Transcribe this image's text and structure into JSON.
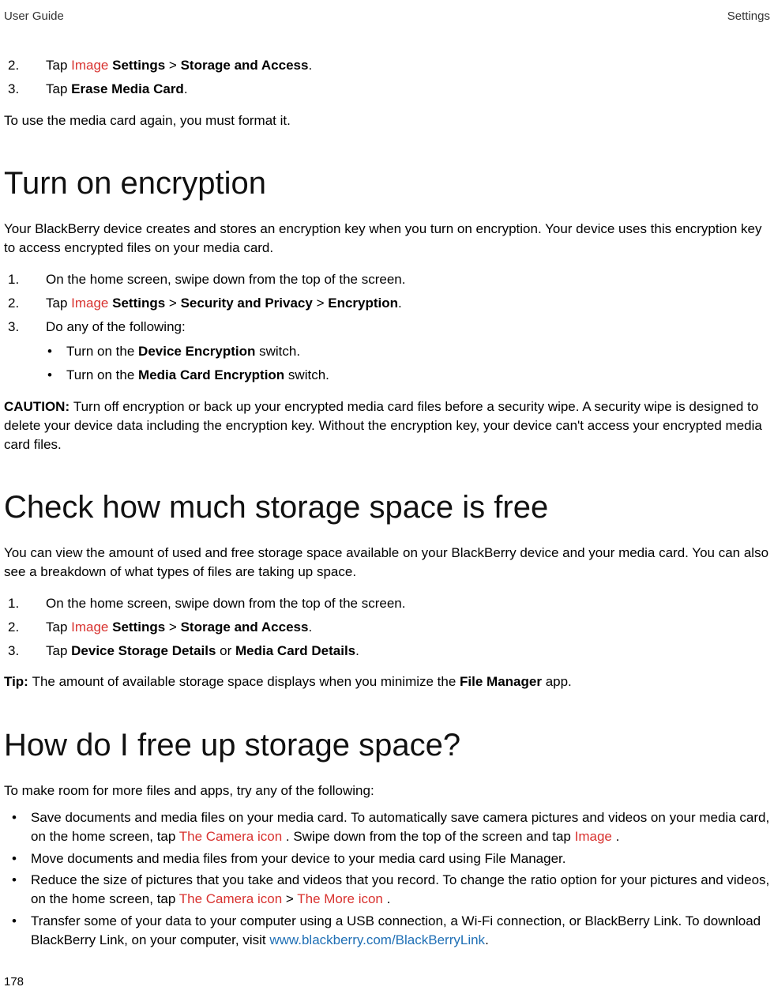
{
  "header": {
    "left": "User Guide",
    "right": "Settings"
  },
  "intro_list": {
    "items": [
      {
        "num": "2.",
        "pre": "Tap ",
        "image": "Image",
        "post": " ",
        "b1": "Settings",
        "sep": " > ",
        "b2": "Storage and Access",
        "end": "."
      },
      {
        "num": "3.",
        "pre": "Tap ",
        "b1": "Erase Media Card",
        "end": "."
      }
    ]
  },
  "intro_para": "To use the media card again, you must format it.",
  "section1": {
    "title": "Turn on encryption",
    "para": "Your BlackBerry device creates and stores an encryption key when you turn on encryption. Your device uses this encryption key to access encrypted files on your media card.",
    "items": [
      {
        "num": "1.",
        "text": "On the home screen, swipe down from the top of the screen."
      },
      {
        "num": "2.",
        "pre": "Tap ",
        "image": "Image",
        "post": " ",
        "b1": "Settings",
        "sep1": " > ",
        "b2": "Security and Privacy",
        "sep2": " > ",
        "b3": "Encryption",
        "end": "."
      },
      {
        "num": "3.",
        "text": "Do any of the following:"
      }
    ],
    "sub_items": [
      {
        "pre": "Turn on the ",
        "b": "Device Encryption",
        "post": " switch."
      },
      {
        "pre": "Turn on the ",
        "b": "Media Card Encryption",
        "post": " switch."
      }
    ],
    "caution_label": "CAUTION: ",
    "caution_text": "Turn off encryption or back up your encrypted media card files before a security wipe. A security wipe is designed to delete your device data including the encryption key. Without the encryption key, your device can't access your encrypted media card files."
  },
  "section2": {
    "title": "Check how much storage space is free",
    "para": "You can view the amount of used and free storage space available on your BlackBerry device and your media card. You can also see a breakdown of what types of files are taking up space.",
    "items": [
      {
        "num": "1.",
        "text": "On the home screen, swipe down from the top of the screen."
      },
      {
        "num": "2.",
        "pre": "Tap ",
        "image": "Image",
        "post": " ",
        "b1": "Settings",
        "sep": " > ",
        "b2": "Storage and Access",
        "end": "."
      },
      {
        "num": "3.",
        "pre": "Tap ",
        "b1": "Device Storage Details",
        "mid": " or ",
        "b2": "Media Card Details",
        "end": "."
      }
    ],
    "tip_label": "Tip: ",
    "tip_pre": "The amount of available storage space displays when you minimize the ",
    "tip_bold": "File Manager",
    "tip_post": " app."
  },
  "section3": {
    "title": "How do I free up storage space?",
    "para": "To make room for more files and apps, try any of the following:",
    "items": [
      {
        "t1": "Save documents and media files on your media card. To automatically save camera pictures and videos on your media card, on the home screen, tap ",
        "img1": "The Camera icon",
        "t2": " . Swipe down from the top of the screen and tap ",
        "img2": "Image",
        "t3": " ."
      },
      {
        "t1": "Move documents and media files from your device to your media card using File Manager."
      },
      {
        "t1": "Reduce the size of pictures that you take and videos that you record. To change the ratio option for your pictures and videos, on the home screen, tap ",
        "img1": "The Camera icon",
        "t2": "  > ",
        "img2": "The More icon",
        "t3": " ."
      },
      {
        "t1": "Transfer some of your data to your computer using a USB connection, a Wi-Fi connection, or BlackBerry Link. To download BlackBerry Link, on your computer, visit ",
        "link": "www.blackberry.com/BlackBerryLink",
        "t2": "."
      }
    ]
  },
  "page_number": "178"
}
